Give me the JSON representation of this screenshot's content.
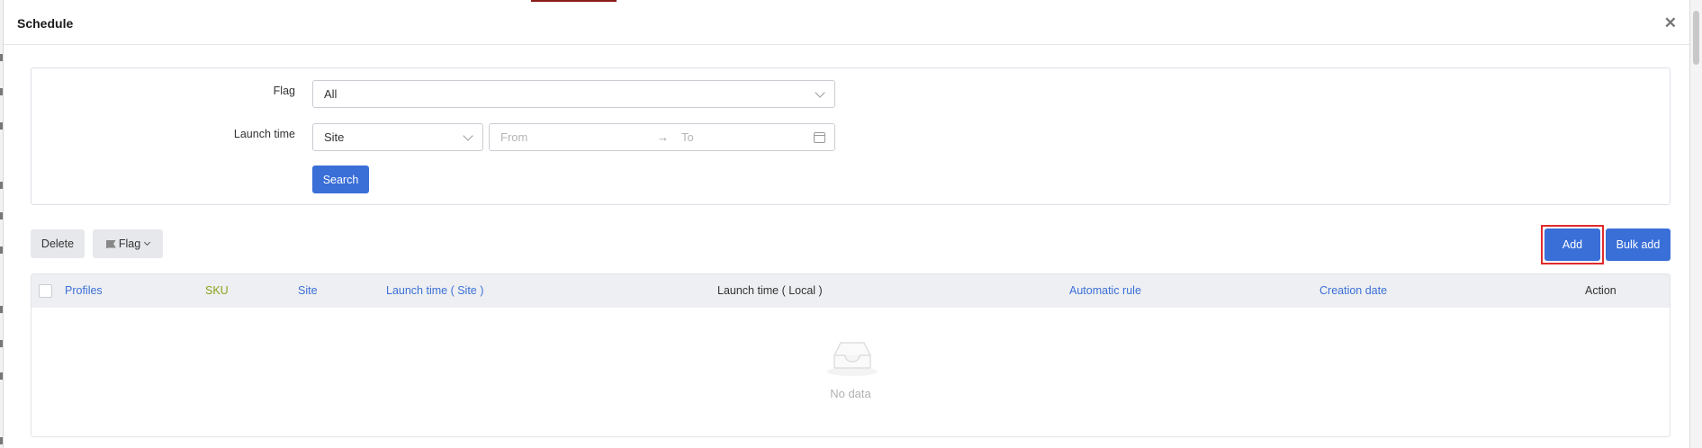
{
  "modal": {
    "title": "Schedule"
  },
  "filters": {
    "flag_label": "Flag",
    "flag_value": "All",
    "launch_time_label": "Launch time",
    "launch_site_value": "Site",
    "date_from_placeholder": "From",
    "date_to_placeholder": "To",
    "range_separator": "→",
    "search_label": "Search"
  },
  "toolbar": {
    "delete_label": "Delete",
    "flag_label": "Flag",
    "add_label": "Add",
    "bulk_add_label": "Bulk add"
  },
  "table": {
    "columns": [
      "Profiles",
      "SKU",
      "Site",
      "Launch time ( Site )",
      "Launch time ( Local )",
      "Automatic rule",
      "Creation date",
      "Action"
    ],
    "empty_text": "No data"
  },
  "colors": {
    "primary": "#3a6fd8",
    "highlight": "#e02b2b",
    "sku_header": "#8aa119"
  },
  "icons": {
    "close": "close-icon",
    "chevron": "chevron-down-icon",
    "calendar": "calendar-icon",
    "flag": "flag-icon",
    "empty": "empty-inbox-icon"
  }
}
